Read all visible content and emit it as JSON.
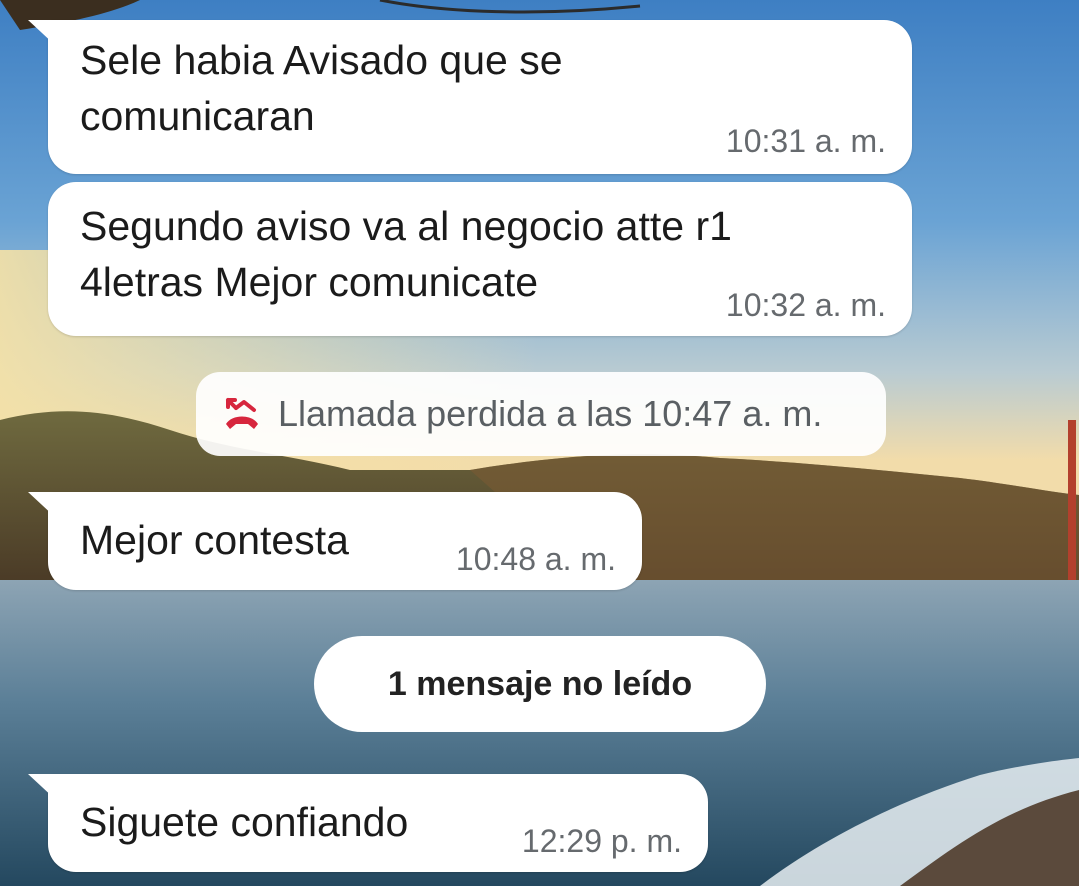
{
  "chat": {
    "messages": [
      {
        "text": "Sele habia Avisado que se\ncomunicaran",
        "time": "10:31 a. m."
      },
      {
        "text": "Segundo aviso va al negocio atte r1\n4letras Mejor comunicate",
        "time": "10:32 a. m."
      },
      {
        "text": "Mejor contesta",
        "time": "10:48 a. m."
      },
      {
        "text": "Siguete confiando",
        "time": "12:29 p. m."
      }
    ],
    "missed_call": {
      "icon": "missed-call-icon",
      "text": "Llamada perdida a las 10:47 a. m."
    },
    "unread_divider": "1 mensaje no leído"
  },
  "colors": {
    "bubble": "#ffffff",
    "missed_call_icon": "#d7263d",
    "time_text": "#666a6e"
  }
}
